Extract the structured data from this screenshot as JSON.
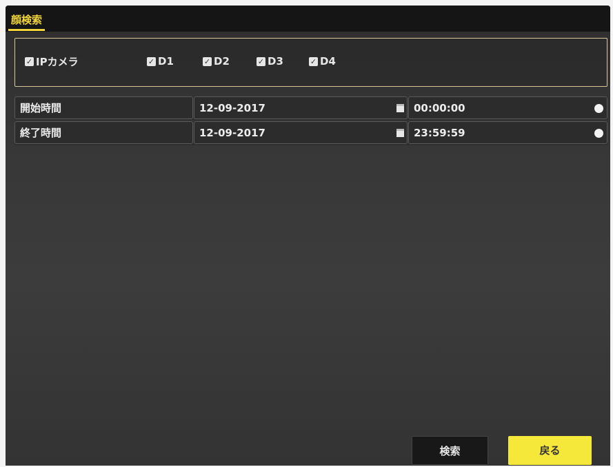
{
  "window": {
    "tab_title": "顔検索"
  },
  "cameras": {
    "group": {
      "label": "IPカメラ",
      "checked": true
    },
    "items": [
      {
        "label": "D1",
        "checked": true
      },
      {
        "label": "D2",
        "checked": true
      },
      {
        "label": "D3",
        "checked": true
      },
      {
        "label": "D4",
        "checked": true
      }
    ]
  },
  "time_range": {
    "start": {
      "label": "開始時間",
      "date": "12-09-2017",
      "time": "00:00:00"
    },
    "end": {
      "label": "終了時間",
      "date": "12-09-2017",
      "time": "23:59:59"
    }
  },
  "buttons": {
    "search": "検索",
    "back": "戻る"
  },
  "colors": {
    "accent": "#f2d53c",
    "back_button": "#f5e83a",
    "panel_bg": "#383838"
  },
  "icons": {
    "checkbox": "checkmark-icon",
    "date_picker": "calendar-icon",
    "time_picker": "clock-icon"
  }
}
